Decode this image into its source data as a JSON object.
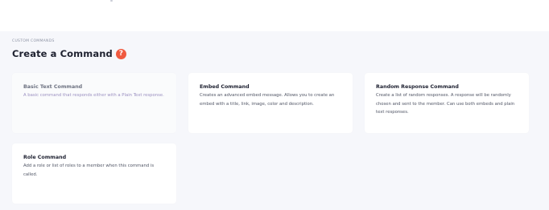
{
  "header": {
    "section_label": "CUSTOM COMMANDS",
    "title": "Create a Command",
    "help_icon": "question-circle-icon",
    "help_symbol": "?"
  },
  "colors": {
    "help_icon": "#f05a40",
    "disabled_description": "#9a8fc0",
    "background": "#f6f7fb"
  },
  "cards": [
    {
      "title": "Basic Text Command",
      "description": "A basic command that responds either with a Plain Text response.",
      "disabled": true
    },
    {
      "title": "Embed Command",
      "description": "Creates an advanced embed message. Allows you to create an embed with a title, link, image, color and description.",
      "disabled": false
    },
    {
      "title": "Random Response Command",
      "description": "Create a list of random responses. A response will be randomly chosen and sent to the member. Can use both embeds and plain text responses.",
      "disabled": false
    },
    {
      "title": "Role Command",
      "description": "Add a role or list of roles to a member when this command is called.",
      "disabled": false
    }
  ]
}
